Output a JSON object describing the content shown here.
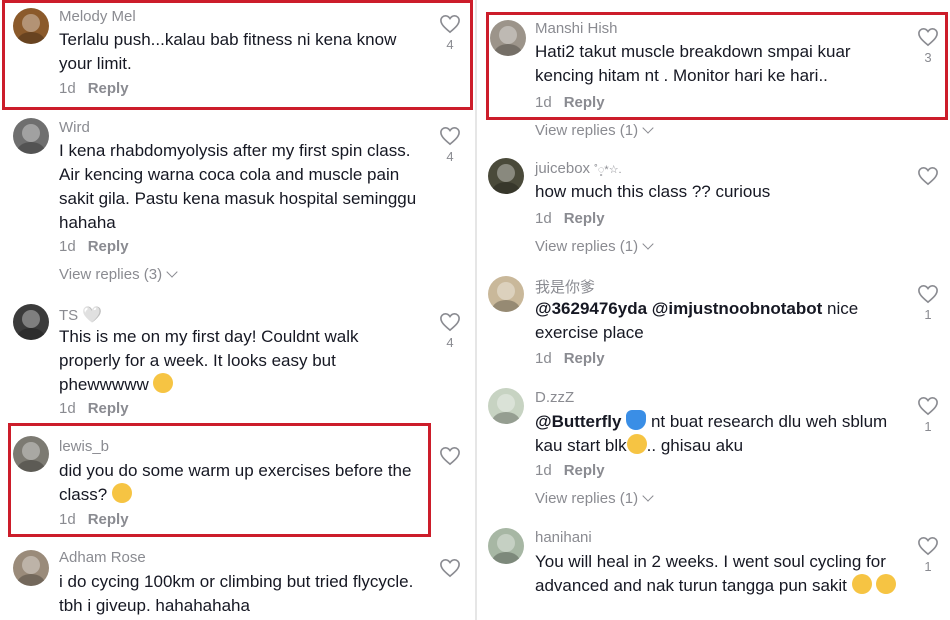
{
  "left": [
    {
      "username": "Melody Mel",
      "text": "Terlalu push...kalau bab fitness ni kena know your limit.",
      "time": "1d",
      "reply": "Reply",
      "likes": "4",
      "avatar_color": "#8b5a2b",
      "view_replies": ""
    },
    {
      "username": "Wird",
      "text": "I kena rhabdomyolysis after my first spin class. Air kencing warna coca cola and muscle pain sakit gila. Pastu kena masuk hospital seminggu hahaha",
      "time": "1d",
      "reply": "Reply",
      "likes": "4",
      "avatar_color": "#6f6f6f",
      "view_replies": "View replies (3)"
    },
    {
      "username": "TS",
      "text": "This is me on my first day! Couldnt walk properly for a week. It looks easy but phewwwww",
      "time": "1d",
      "reply": "Reply",
      "likes": "4",
      "avatar_color": "#3b3b3b",
      "view_replies": "",
      "name_suffix_icon": "white-heart-icon",
      "name_suffix_glyph": "🤍",
      "emoji_after": "grinning-sweat-emoji"
    },
    {
      "username": "lewis_b",
      "text": "did you do some warm up exercises before the class?",
      "time": "1d",
      "reply": "Reply",
      "likes": "",
      "avatar_color": "#7c7a72",
      "view_replies": "",
      "emoji_after": "flushed-face-emoji"
    },
    {
      "username": "Adham Rose",
      "text": "i do cycing 100km or climbing but tried flycycle. tbh i giveup. hahahahaha",
      "time": "",
      "reply": "",
      "likes": "",
      "avatar_color": "#9a8b7a",
      "view_replies": ""
    }
  ],
  "right": [
    {
      "username": "Manshi Hish",
      "text": "Hati2 takut muscle breakdown smpai kuar kencing hitam nt . Monitor hari ke hari..",
      "time": "1d",
      "reply": "Reply",
      "likes": "3",
      "avatar_color": "#9c948a",
      "view_replies": "View replies (1)"
    },
    {
      "username": "juicebox",
      "username_suffix": "˚◌̥*☆.",
      "text": "how much this class ?? curious",
      "time": "1d",
      "reply": "Reply",
      "likes": "",
      "avatar_color": "#4a4a3a",
      "view_replies": "View replies (1)"
    },
    {
      "username": "我是你爹",
      "mention1": "@3629476yda",
      "mention2": "@imjustnoobnotabot",
      "text": "nice exercise place",
      "time": "1d",
      "reply": "Reply",
      "likes": "1",
      "avatar_color": "#c9b89a",
      "view_replies": ""
    },
    {
      "username": "D.zzZ",
      "mention1": "@Butterfly",
      "text_a": "nt buat research dlu weh sblum kau start blk",
      "text_b": ".. ghisau aku",
      "time": "1d",
      "reply": "Reply",
      "likes": "1",
      "avatar_color": "#c7d3c2",
      "view_replies": "View replies (1)"
    },
    {
      "username": "hanihani",
      "text": "You will heal in 2 weeks. I went soul cycling for advanced and nak turun tangga pun sakit",
      "time": "",
      "reply": "",
      "likes": "1",
      "avatar_color": "#a7b7a4",
      "view_replies": ""
    }
  ],
  "colors": {
    "highlight": "#cc1d2a",
    "muted": "#8a8b91",
    "text": "#161823"
  }
}
